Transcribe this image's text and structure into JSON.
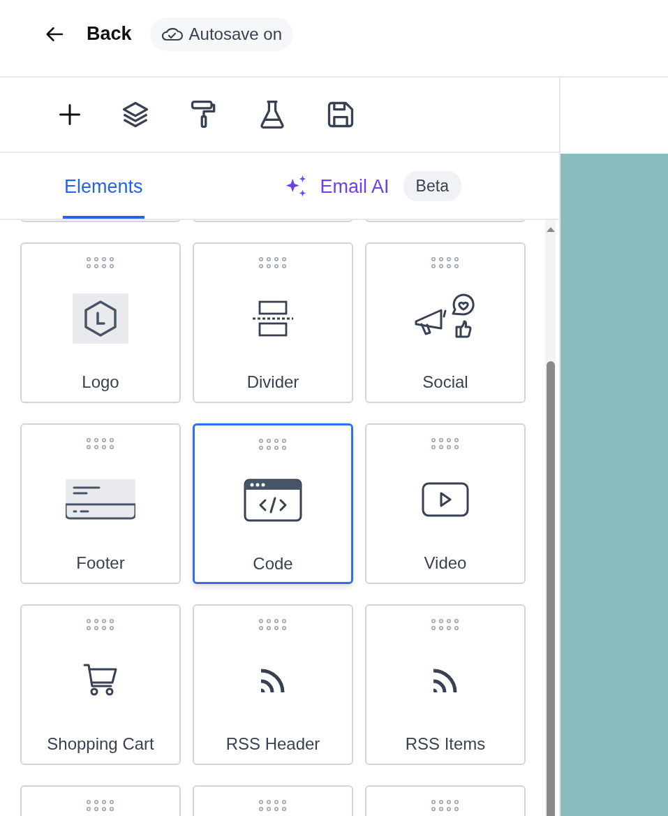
{
  "header": {
    "back_label": "Back",
    "autosave_label": "Autosave on"
  },
  "toolbar": [
    {
      "kind": "add"
    },
    {
      "kind": "layers"
    },
    {
      "kind": "paint"
    },
    {
      "kind": "test"
    },
    {
      "kind": "save"
    }
  ],
  "tabs": [
    {
      "label": "Elements",
      "selected": true,
      "kind": "plain"
    },
    {
      "label": "Email AI",
      "selected": false,
      "kind": "ai",
      "badge": "Beta"
    }
  ],
  "elements": [
    {
      "label": "Logo",
      "kind": "logo",
      "selected": false
    },
    {
      "label": "Divider",
      "kind": "divider",
      "selected": false
    },
    {
      "label": "Social",
      "kind": "social",
      "selected": false
    },
    {
      "label": "Footer",
      "kind": "footer",
      "selected": false
    },
    {
      "label": "Code",
      "kind": "code",
      "selected": true
    },
    {
      "label": "Video",
      "kind": "video",
      "selected": false
    },
    {
      "label": "Shopping Cart",
      "kind": "cart",
      "selected": false
    },
    {
      "label": "RSS Header",
      "kind": "rss",
      "selected": false
    },
    {
      "label": "RSS Items",
      "kind": "rss",
      "selected": false
    }
  ]
}
